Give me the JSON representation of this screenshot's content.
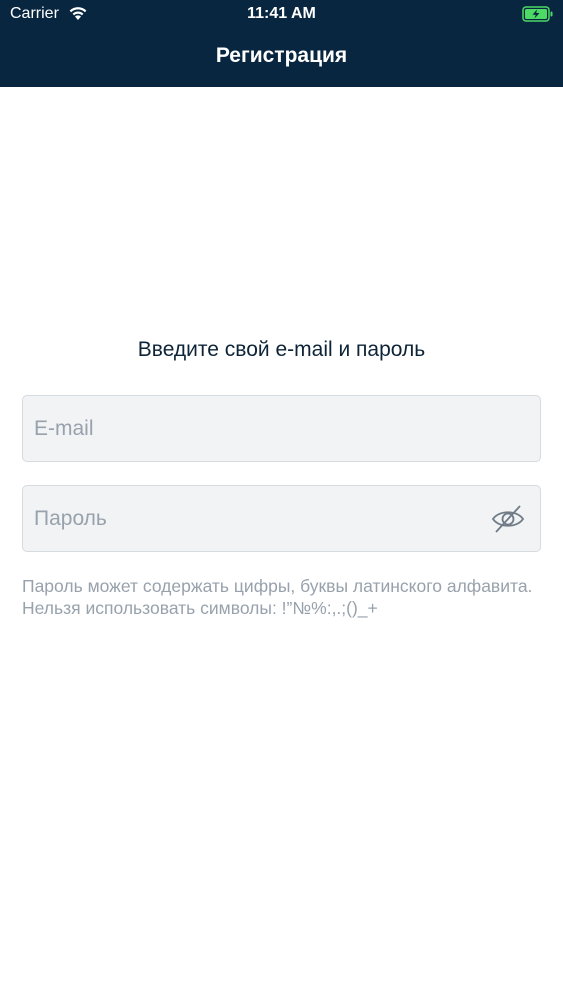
{
  "status_bar": {
    "carrier": "Carrier",
    "time": "11:41 AM",
    "wifi_icon": "wifi-icon",
    "battery_icon": "battery-charging-icon"
  },
  "nav": {
    "title": "Регистрация"
  },
  "form": {
    "prompt": "Введите свой e-mail и пароль",
    "email": {
      "placeholder": "E-mail",
      "value": ""
    },
    "password": {
      "placeholder": "Пароль",
      "value": "",
      "toggle_icon": "eye-slash-icon"
    },
    "hint": "Пароль может содержать цифры, буквы латинского алфавита. Нельзя использовать символы: !”№%:,.;()_+"
  },
  "colors": {
    "header_bg": "#082640",
    "battery_green": "#4cd964",
    "placeholder": "#98a2ac",
    "field_bg": "#f1f3f5"
  }
}
